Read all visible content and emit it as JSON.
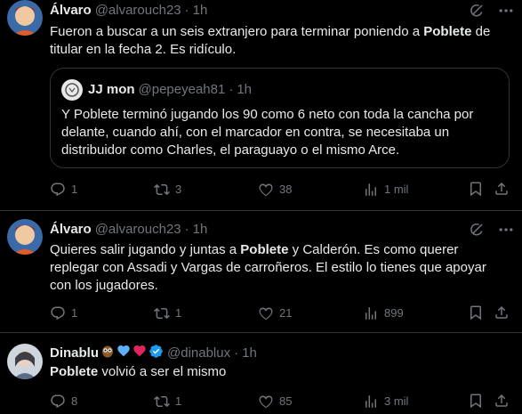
{
  "tweets": [
    {
      "name": "Álvaro",
      "handle": "@alvarouch23",
      "time": "1h",
      "body": {
        "pre": "Fueron a buscar a un seis extranjero para terminar poniendo a ",
        "bold": "Poblete",
        "post": " de titular en la fecha 2. Es ridículo."
      },
      "quote": {
        "name": "JJ mon",
        "handle": "@pepeyeah81",
        "time": "1h",
        "text": "Y Poblete terminó jugando los 90 como 6 neto con toda la cancha por delante, cuando ahí, con el marcador en contra, se necesitaba un distribuidor como Charles, el paraguayo o el mismo Arce."
      },
      "replies": "1",
      "reposts": "3",
      "likes": "38",
      "views": "1 mil"
    },
    {
      "name": "Álvaro",
      "handle": "@alvarouch23",
      "time": "1h",
      "body": {
        "pre": "Quieres salir jugando y juntas a ",
        "bold": "Poblete",
        "post": " y Calderón. Es como querer replegar con Assadi y Vargas de carroñeros. El estilo lo tienes que apoyar con los jugadores."
      },
      "replies": "1",
      "reposts": "1",
      "likes": "21",
      "views": "899"
    },
    {
      "name": "Dinablu",
      "handle": "@dinablux",
      "time": "1h",
      "body": {
        "pre": "",
        "bold": "Poblete",
        "post": " volvió a ser el mismo"
      },
      "replies": "8",
      "reposts": "1",
      "likes": "85",
      "views": "3 mil"
    }
  ],
  "colors": {
    "background": "#000000",
    "text": "#e7e9ea",
    "muted": "#71767b",
    "border": "#2f3336",
    "verified": "#1d9bf0",
    "heart_red": "#f91880",
    "heart_blue": "#5db0ff"
  }
}
